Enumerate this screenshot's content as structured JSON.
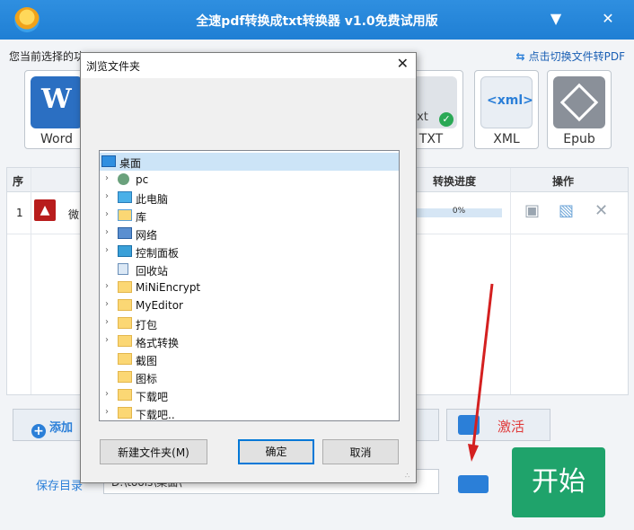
{
  "app": {
    "title": "全速pdf转换成txt转换器 v1.0免费试用版",
    "current_label": "您当前选择的功",
    "current_value": "",
    "switch_link": "点击切换文件转PDF"
  },
  "tiles": [
    {
      "label": "Word",
      "color": "#2b6fc2"
    },
    {
      "label": "TXT",
      "color": "#dfe3e8"
    },
    {
      "label": "XML",
      "color": "#e9eef4"
    },
    {
      "label": "Epub",
      "color": "#8a9099"
    }
  ],
  "table": {
    "headers": {
      "index": "序",
      "progress": "转换进度",
      "action": "操作"
    },
    "rows": [
      {
        "index": "1",
        "name": "微",
        "progress_text": "0%",
        "progress": 0
      }
    ]
  },
  "buttons": {
    "add": "添加",
    "activate": "激活",
    "start": "开始"
  },
  "save": {
    "label": "保存目录",
    "value": "D:\\tools\\桌面\\"
  },
  "dialog": {
    "title": "浏览文件夹",
    "tree": [
      {
        "label": "桌面",
        "icon": "desktop",
        "expandable": false,
        "level": 0,
        "selected": true
      },
      {
        "label": "pc",
        "icon": "user",
        "expandable": true,
        "level": 1
      },
      {
        "label": "此电脑",
        "icon": "pc",
        "expandable": true,
        "level": 1
      },
      {
        "label": "库",
        "icon": "library",
        "expandable": true,
        "level": 1
      },
      {
        "label": "网络",
        "icon": "network",
        "expandable": true,
        "level": 1
      },
      {
        "label": "控制面板",
        "icon": "control-panel",
        "expandable": true,
        "level": 1
      },
      {
        "label": "回收站",
        "icon": "recycle-bin",
        "expandable": false,
        "level": 1
      },
      {
        "label": "MiNiEncrypt",
        "icon": "folder",
        "expandable": true,
        "level": 1
      },
      {
        "label": "MyEditor",
        "icon": "folder",
        "expandable": true,
        "level": 1
      },
      {
        "label": "打包",
        "icon": "folder",
        "expandable": true,
        "level": 1
      },
      {
        "label": "格式转换",
        "icon": "folder",
        "expandable": true,
        "level": 1
      },
      {
        "label": "截图",
        "icon": "folder",
        "expandable": false,
        "level": 1
      },
      {
        "label": "图标",
        "icon": "folder",
        "expandable": false,
        "level": 1
      },
      {
        "label": "下载吧",
        "icon": "folder",
        "expandable": true,
        "level": 1
      },
      {
        "label": "下载吧..",
        "icon": "folder",
        "expandable": true,
        "level": 1
      }
    ],
    "new_folder": "新建文件夹(M)",
    "ok": "确定",
    "cancel": "取消"
  },
  "colors": {
    "titlebar": "#1f7fd4",
    "accent": "#2b7fd8",
    "start": "#1fa36b",
    "highlight": "#e03a3a",
    "arrow": "#d42020"
  }
}
